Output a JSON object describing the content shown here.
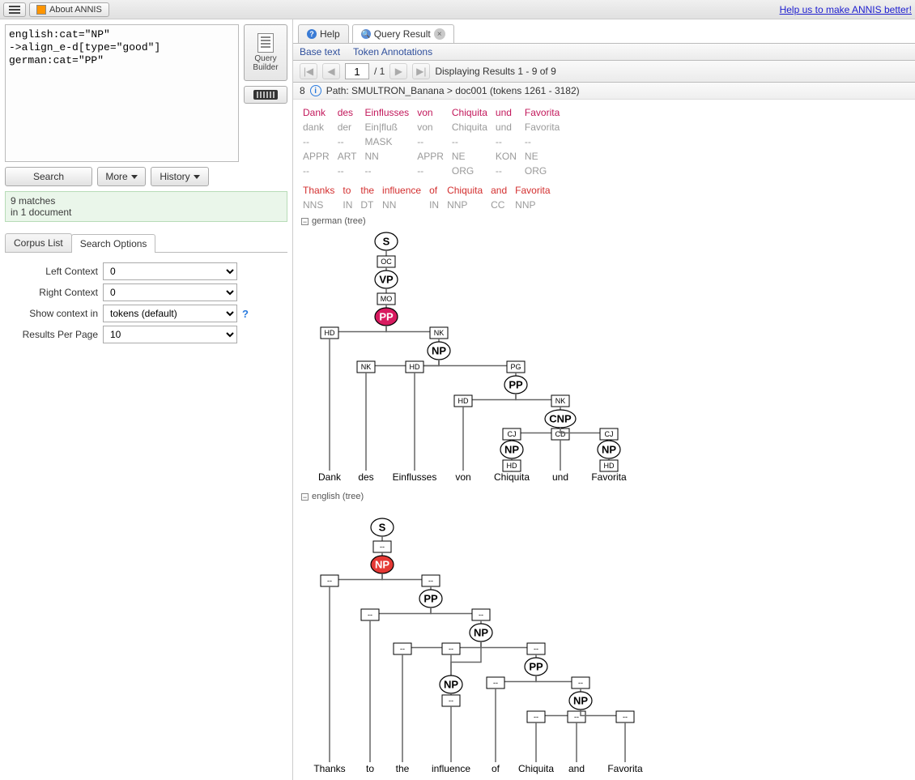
{
  "top": {
    "about": "About ANNIS",
    "help_link": "Help us to make ANNIS better!"
  },
  "query": {
    "text": "english:cat=\"NP\"\n->align_e-d[type=\"good\"]\ngerman:cat=\"PP\"",
    "builder_label1": "Query",
    "builder_label2": "Builder"
  },
  "buttons": {
    "search": "Search",
    "more": "More",
    "history": "History"
  },
  "status": {
    "line1": "9 matches",
    "line2": "in 1 document"
  },
  "sidetabs": {
    "corpus": "Corpus List",
    "options": "Search Options"
  },
  "options": {
    "left_context_label": "Left Context",
    "left_context_value": "0",
    "right_context_label": "Right Context",
    "right_context_value": "0",
    "show_context_label": "Show context in",
    "show_context_value": "tokens (default)",
    "results_per_page_label": "Results Per Page",
    "results_per_page_value": "10"
  },
  "right_tabs": {
    "help": "Help",
    "query_result": "Query Result"
  },
  "mode": {
    "base_text": "Base text",
    "token_anno": "Token Annotations"
  },
  "pager": {
    "page": "1",
    "total": "/ 1",
    "display": "Displaying Results 1 - 9 of 9"
  },
  "path": {
    "num": "8",
    "text": "Path: SMULTRON_Banana > doc001 (tokens 1261 - 3182)"
  },
  "tokens_de": {
    "row1": [
      "Dank",
      "des",
      "Einflusses",
      "von",
      "Chiquita",
      "und",
      "Favorita"
    ],
    "row2": [
      "dank",
      "der",
      "Ein|fluß",
      "von",
      "Chiquita",
      "und",
      "Favorita"
    ],
    "row3": [
      "--",
      "--",
      "MASK",
      "--",
      "--",
      "--",
      "--"
    ],
    "row4": [
      "APPR",
      "ART",
      "NN",
      "APPR",
      "NE",
      "KON",
      "NE"
    ],
    "row5": [
      "--",
      "--",
      "--",
      "--",
      "ORG",
      "--",
      "ORG"
    ]
  },
  "tokens_en": {
    "row1": [
      "Thanks",
      "to",
      "the",
      "influence",
      "of",
      "Chiquita",
      "and",
      "Favorita"
    ],
    "row2": [
      "NNS",
      "IN",
      "DT",
      "NN",
      "IN",
      "NNP",
      "CC",
      "NNP"
    ]
  },
  "tree_titles": {
    "de": "german (tree)",
    "en": "english (tree)"
  },
  "tree_de": {
    "nodes": {
      "S": "S",
      "OC": "OC",
      "VP": "VP",
      "MO": "MO",
      "PP": "PP",
      "HD": "HD",
      "NK": "NK",
      "NP": "NP",
      "PG": "PG",
      "CNP": "CNP",
      "CJ": "CJ",
      "CD": "CD"
    },
    "leaves": [
      "Dank",
      "des",
      "Einflusses",
      "von",
      "Chiquita",
      "und",
      "Favorita"
    ]
  },
  "tree_en": {
    "leaves": [
      "Thanks",
      "to",
      "the",
      "influence",
      "of",
      "Chiquita",
      "and",
      "Favorita"
    ]
  }
}
